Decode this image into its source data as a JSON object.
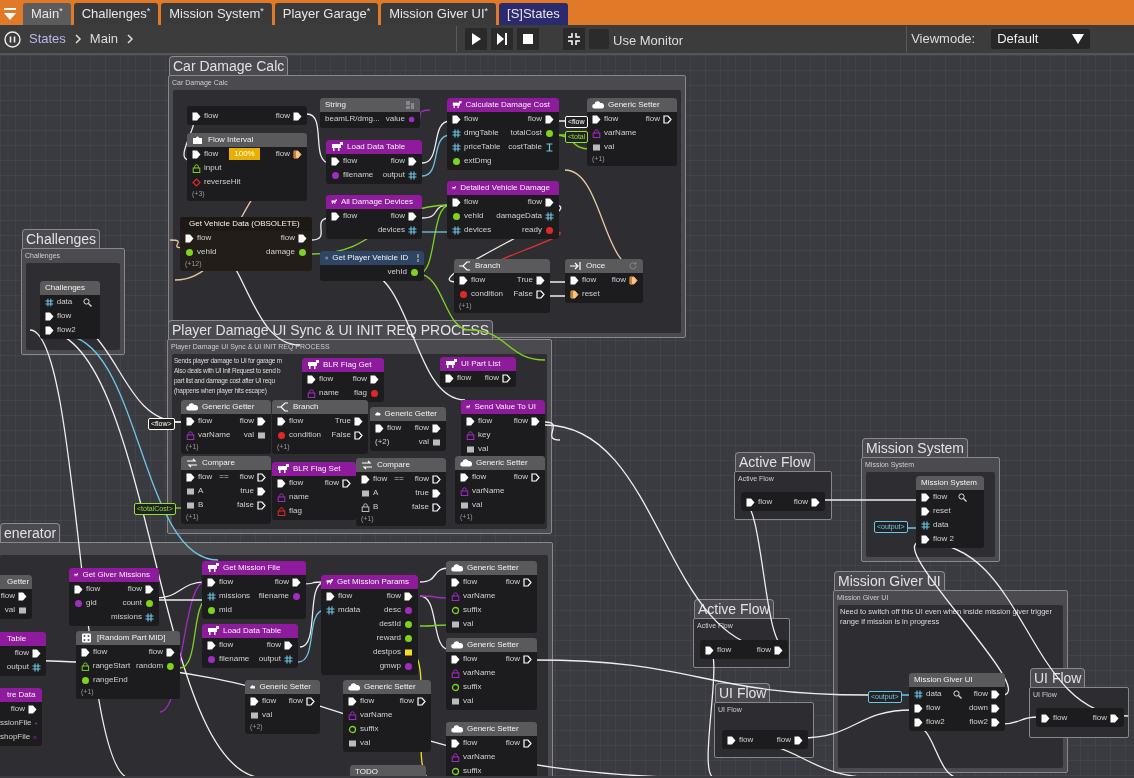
{
  "tabs": [
    {
      "label": "Main$^{*}$",
      "kind": "graph",
      "selected": true
    },
    {
      "label": "Challenges$^{*}$",
      "kind": "graph",
      "selected": false
    },
    {
      "label": "Mission System$^{*}$",
      "kind": "graph",
      "selected": false
    },
    {
      "label": "Player Garage$^{*}$",
      "kind": "graph",
      "selected": false
    },
    {
      "label": "Mission Giver UI$^{*}$",
      "kind": "graph",
      "selected": false
    },
    {
      "label": "[S]States",
      "kind": "state",
      "selected": false
    }
  ],
  "toolbar": {
    "breadcrumb": [
      {
        "label": "States",
        "kind": "link"
      },
      {
        "label": "Main",
        "kind": "current"
      }
    ],
    "use_monitor": {
      "label": "Use Monitor",
      "checked": false
    },
    "viewmode": {
      "label": "Viewmode:",
      "value": "Default"
    }
  },
  "groups": [
    {
      "title": "Car Damage Calc",
      "subtitle": "Car Damage Calc",
      "kind": "panel"
    },
    {
      "title": "Challenges",
      "subtitle": "Challenges",
      "kind": "panel"
    },
    {
      "title": "Player Damage UI Sync & UI INIT REQ PROCESS",
      "subtitle": "Player Damage UI Sync & UI INIT REQ PROCESS",
      "comment": "Sends player damage to UI for garage m\nAlso deals with UI Init Request to send b\npart list and damage cost after UI requ\n(happens when player hits escape)",
      "kind": "panel"
    },
    {
      "title": "enerator",
      "kind": "panel"
    },
    {
      "title": "Active Flow",
      "subtitle": "Active Flow",
      "kind": "compact"
    },
    {
      "title": "Mission System",
      "subtitle": "Mission System",
      "kind": "panel"
    },
    {
      "title": "Active Flow",
      "subtitle": "Active Flow",
      "kind": "compact"
    },
    {
      "title": "Mission Giver UI",
      "subtitle": "Mission Giver UI",
      "comment": "Need to switch off this UI even when inside mission giver trigger range if mission is in progress",
      "kind": "panel"
    },
    {
      "title": "UI Flow",
      "subtitle": "UI Flow",
      "kind": "compact"
    },
    {
      "title": "UI Flow",
      "subtitle": "UI Flow",
      "kind": "compact"
    }
  ],
  "reroutes": [
    {
      "label": "<flow",
      "kind": "flow"
    },
    {
      "label": "<total",
      "kind": "number"
    },
    {
      "label": "<flow>",
      "kind": "flow"
    },
    {
      "label": "<totalCost>",
      "kind": "number"
    },
    {
      "label": "<output>",
      "kind": "table"
    },
    {
      "label": "<output>",
      "kind": "table"
    }
  ],
  "nodes": [
    {
      "kind": "plain",
      "rows": [
        {
          "in": {
            "kind": "flow",
            "label": "flow"
          },
          "out": {
            "kind": "flow",
            "label": "flow"
          }
        }
      ]
    },
    {
      "kind": "interval",
      "title": "Flow Interval",
      "rows": [
        {
          "in": {
            "kind": "flow",
            "label": "flow"
          },
          "badge": "100%",
          "out": {
            "kind": "flow-orange",
            "label": "flow"
          }
        },
        {
          "in": {
            "kind": "lock-green",
            "label": "input"
          }
        },
        {
          "in": {
            "kind": "diamond-red",
            "label": "reverseHit"
          }
        }
      ],
      "footer": "(+3)"
    },
    {
      "kind": "string",
      "title": "String",
      "rows": [
        {
          "in": {
            "label": "beamLR/dmg..."
          },
          "out": {
            "kind": "string",
            "label": "value"
          }
        }
      ]
    },
    {
      "kind": "function",
      "title": "Load Data Table",
      "rows": [
        {
          "in": {
            "kind": "flow",
            "label": "flow"
          },
          "out": {
            "kind": "flow",
            "label": "flow"
          }
        },
        {
          "in": {
            "kind": "string",
            "label": "filename"
          },
          "out": {
            "kind": "table",
            "label": "output"
          }
        }
      ]
    },
    {
      "kind": "function",
      "title": "All Damage Devices",
      "rows": [
        {
          "in": {
            "kind": "flow",
            "label": "flow"
          },
          "out": {
            "kind": "flow",
            "label": "flow"
          }
        },
        {
          "out": {
            "kind": "table",
            "label": "devices"
          }
        }
      ]
    },
    {
      "kind": "vehicle",
      "title": "Get Vehicle Data (OBSOLETE)",
      "rows": [
        {
          "in": {
            "kind": "flow",
            "label": "flow"
          },
          "out": {
            "kind": "flow",
            "label": "flow"
          }
        },
        {
          "in": {
            "kind": "number",
            "label": "vehId"
          },
          "out": {
            "kind": "number",
            "label": "damage"
          }
        }
      ],
      "footer": "(+12)"
    },
    {
      "kind": "global",
      "title": "Get Player Vehicle ID",
      "rows": [
        {
          "out": {
            "kind": "number",
            "label": "vehId"
          }
        }
      ]
    },
    {
      "kind": "function",
      "title": "Calculate Damage Cost",
      "rows": [
        {
          "in": {
            "kind": "flow",
            "label": "flow"
          },
          "out": {
            "kind": "flow",
            "label": "flow"
          }
        },
        {
          "in": {
            "kind": "table",
            "label": "dmgTable"
          },
          "out": {
            "kind": "number",
            "label": "totalCost"
          }
        },
        {
          "in": {
            "kind": "table",
            "label": "priceTable"
          },
          "out": {
            "kind": "cast",
            "label": "costTable"
          }
        },
        {
          "in": {
            "kind": "number",
            "label": "extDmg"
          }
        }
      ]
    },
    {
      "kind": "function",
      "title": "Detailed Vehicle Damage",
      "rows": [
        {
          "in": {
            "kind": "flow",
            "label": "flow"
          },
          "out": {
            "kind": "flow",
            "label": "flow"
          }
        },
        {
          "in": {
            "kind": "number",
            "label": "vehId"
          },
          "out": {
            "kind": "table",
            "label": "damageData"
          }
        },
        {
          "in": {
            "kind": "table",
            "label": "devices"
          },
          "out": {
            "kind": "bool",
            "label": "ready"
          }
        }
      ]
    },
    {
      "kind": "cloud",
      "title": "Generic Setter",
      "rows": [
        {
          "in": {
            "kind": "flow",
            "label": "flow"
          },
          "out": {
            "kind": "flow-open",
            "label": "flow"
          }
        },
        {
          "in": {
            "kind": "lock",
            "label": "varName"
          }
        },
        {
          "in": {
            "kind": "any",
            "label": "val"
          }
        }
      ],
      "footer": "(+1)"
    },
    {
      "kind": "branch",
      "title": "Branch",
      "rows": [
        {
          "in": {
            "kind": "flow",
            "label": "flow"
          },
          "out": {
            "kind": "flow",
            "label": "True"
          }
        },
        {
          "in": {
            "kind": "bool",
            "label": "condition"
          },
          "out": {
            "kind": "flow-open",
            "label": "False"
          }
        }
      ],
      "footer": "(+1)"
    },
    {
      "kind": "once",
      "title": "Once",
      "rows": [
        {
          "in": {
            "kind": "flow",
            "label": "flow"
          },
          "out": {
            "kind": "flow-orange",
            "label": "flow"
          }
        },
        {
          "in": {
            "kind": "flow-orange",
            "label": "reset"
          }
        }
      ]
    },
    {
      "kind": "subgraph",
      "title": "Challenges",
      "rows": [
        {
          "in": {
            "kind": "table",
            "label": "data"
          },
          "inspect": true
        },
        {
          "in": {
            "kind": "flow",
            "label": "flow"
          }
        },
        {
          "in": {
            "kind": "flow",
            "label": "flow2"
          }
        }
      ]
    },
    {
      "kind": "function",
      "title": "BLR Flag Get",
      "rows": [
        {
          "in": {
            "kind": "flow",
            "label": "flow"
          },
          "out": {
            "kind": "flow",
            "label": "flow"
          }
        },
        {
          "in": {
            "kind": "lock",
            "label": "name"
          },
          "out": {
            "kind": "bool",
            "label": "flag"
          }
        }
      ]
    },
    {
      "kind": "function",
      "title": "UI Part List",
      "rows": [
        {
          "in": {
            "kind": "flow",
            "label": "flow"
          },
          "out": {
            "kind": "flow-open",
            "label": "flow"
          }
        }
      ]
    },
    {
      "kind": "cloud",
      "title": "Generic Getter",
      "rows": [
        {
          "in": {
            "kind": "flow",
            "label": "flow"
          },
          "out": {
            "kind": "flow",
            "label": "flow"
          }
        },
        {
          "in": {
            "kind": "lock",
            "label": "varName"
          },
          "out": {
            "kind": "any",
            "label": "val"
          }
        }
      ],
      "footer": "(+1)"
    },
    {
      "kind": "branch",
      "title": "Branch",
      "rows": [
        {
          "in": {
            "kind": "flow",
            "label": "flow"
          },
          "out": {
            "kind": "flow",
            "label": "True"
          }
        },
        {
          "in": {
            "kind": "bool",
            "label": "condition"
          },
          "out": {
            "kind": "flow-open",
            "label": "False"
          }
        }
      ],
      "footer": "(+1)"
    },
    {
      "kind": "cloud",
      "title": "Generic Getter",
      "rows": [
        {
          "in": {
            "kind": "flow",
            "label": "flow"
          },
          "out": {
            "kind": "flow",
            "label": "flow"
          }
        },
        {
          "in": {
            "label": "(+2)"
          },
          "out": {
            "kind": "any",
            "label": "val"
          }
        }
      ]
    },
    {
      "kind": "function",
      "title": "Send Value To UI",
      "rows": [
        {
          "in": {
            "kind": "flow",
            "label": "flow"
          },
          "out": {
            "kind": "flow",
            "label": "flow"
          }
        },
        {
          "in": {
            "kind": "lock",
            "label": "key"
          }
        },
        {
          "in": {
            "kind": "any",
            "label": "val"
          }
        }
      ]
    },
    {
      "kind": "compare",
      "title": "Compare",
      "rows": [
        {
          "in": {
            "kind": "flow",
            "label": "flow"
          },
          "op": "==",
          "out": {
            "kind": "flow-open",
            "label": "flow"
          }
        },
        {
          "in": {
            "kind": "any",
            "label": "A"
          },
          "out": {
            "kind": "flow",
            "label": "true"
          }
        },
        {
          "in": {
            "kind": "any",
            "label": "B"
          },
          "out": {
            "kind": "flow-open",
            "label": "false"
          }
        }
      ],
      "footer": "(+1)"
    },
    {
      "kind": "function",
      "title": "BLR Flag Set",
      "rows": [
        {
          "in": {
            "kind": "flow",
            "label": "flow"
          },
          "out": {
            "kind": "flow-open",
            "label": "flow"
          }
        },
        {
          "in": {
            "kind": "lock",
            "label": "name"
          }
        },
        {
          "in": {
            "kind": "lock-red",
            "label": "flag"
          }
        }
      ]
    },
    {
      "kind": "compare",
      "title": "Compare",
      "rows": [
        {
          "in": {
            "kind": "flow",
            "label": "flow"
          },
          "op": "==",
          "out": {
            "kind": "flow-open",
            "label": "flow"
          }
        },
        {
          "in": {
            "kind": "any",
            "label": "A"
          },
          "out": {
            "kind": "flow",
            "label": "true"
          }
        },
        {
          "in": {
            "kind": "lock-gray",
            "label": "B"
          },
          "out": {
            "kind": "flow-open",
            "label": "false"
          }
        }
      ],
      "footer": "(+1)"
    },
    {
      "kind": "cloud",
      "title": "Generic Setter",
      "rows": [
        {
          "in": {
            "kind": "flow",
            "label": "flow"
          },
          "out": {
            "kind": "flow-open",
            "label": "flow"
          }
        },
        {
          "in": {
            "kind": "lock",
            "label": "varName"
          }
        },
        {
          "in": {
            "kind": "any",
            "label": "val"
          }
        }
      ],
      "footer": "(+1)"
    },
    {
      "kind": "cloud",
      "title": "Getter",
      "partial": true,
      "rows": [
        {
          "out": {
            "kind": "flow",
            "label": "flow"
          }
        },
        {
          "out": {
            "kind": "any",
            "label": "val"
          }
        }
      ]
    },
    {
      "kind": "function",
      "title": "Table",
      "partial": true,
      "rows": [
        {
          "out": {
            "kind": "flow",
            "label": "flow"
          }
        },
        {
          "out": {
            "kind": "table",
            "label": "output"
          }
        }
      ]
    },
    {
      "kind": "function",
      "title": "tre Data",
      "partial": true,
      "rows": [
        {
          "out": {
            "kind": "flow",
            "label": "flow"
          }
        },
        {
          "out": {
            "kind": "string",
            "label": "ssionFile"
          }
        },
        {
          "out": {
            "kind": "string-open",
            "label": "shopFile"
          }
        }
      ]
    },
    {
      "kind": "function",
      "title": "Get Giver Missions",
      "rows": [
        {
          "in": {
            "kind": "flow",
            "label": "flow"
          },
          "out": {
            "kind": "flow",
            "label": "flow"
          }
        },
        {
          "in": {
            "kind": "string",
            "label": "gid"
          },
          "out": {
            "kind": "number",
            "label": "count"
          }
        },
        {
          "out": {
            "kind": "table",
            "label": "missions"
          }
        }
      ]
    },
    {
      "kind": "random",
      "title": "[Random Part MID]",
      "rows": [
        {
          "in": {
            "kind": "flow",
            "label": "flow"
          },
          "out": {
            "kind": "flow",
            "label": "flow"
          }
        },
        {
          "in": {
            "kind": "lock-green",
            "label": "rangeStart"
          },
          "out": {
            "kind": "number",
            "label": "random"
          }
        },
        {
          "in": {
            "kind": "number",
            "label": "rangeEnd"
          }
        }
      ],
      "footer": "(+1)"
    },
    {
      "kind": "function",
      "title": "Get Mission File",
      "rows": [
        {
          "in": {
            "kind": "flow",
            "label": "flow"
          },
          "out": {
            "kind": "flow",
            "label": "flow"
          }
        },
        {
          "in": {
            "kind": "table",
            "label": "missions"
          },
          "out": {
            "kind": "string",
            "label": "filename"
          }
        },
        {
          "in": {
            "kind": "number",
            "label": "mid"
          }
        }
      ]
    },
    {
      "kind": "function",
      "title": "Load Data Table",
      "rows": [
        {
          "in": {
            "kind": "flow",
            "label": "flow"
          },
          "out": {
            "kind": "flow",
            "label": "flow"
          }
        },
        {
          "in": {
            "kind": "string",
            "label": "filename"
          },
          "out": {
            "kind": "table",
            "label": "output"
          }
        }
      ]
    },
    {
      "kind": "function",
      "title": "Get Mission Params",
      "rows": [
        {
          "in": {
            "kind": "flow",
            "label": "flow"
          },
          "out": {
            "kind": "flow",
            "label": "flow"
          }
        },
        {
          "in": {
            "kind": "table",
            "label": "mdata"
          },
          "out": {
            "kind": "string",
            "label": "desc"
          }
        },
        {
          "out": {
            "kind": "number",
            "label": "destId"
          }
        },
        {
          "out": {
            "kind": "number",
            "label": "reward"
          }
        },
        {
          "out": {
            "kind": "vec",
            "label": "destpos"
          }
        },
        {
          "out": {
            "kind": "string",
            "label": "gmwp"
          }
        }
      ]
    },
    {
      "kind": "cloud",
      "title": "Generic Setter",
      "rows": [
        {
          "in": {
            "kind": "flow",
            "label": "flow"
          },
          "out": {
            "kind": "flow-open",
            "label": "flow"
          }
        },
        {
          "in": {
            "kind": "lock",
            "label": "varName"
          }
        },
        {
          "in": {
            "kind": "ring",
            "label": "suffix"
          }
        },
        {
          "in": {
            "kind": "any",
            "label": "val"
          }
        }
      ]
    },
    {
      "kind": "cloud",
      "title": "Generic Setter",
      "rows": [
        {
          "in": {
            "kind": "flow",
            "label": "flow"
          },
          "out": {
            "kind": "flow-open",
            "label": "flow"
          }
        },
        {
          "in": {
            "kind": "lock",
            "label": "varName"
          }
        },
        {
          "in": {
            "kind": "ring",
            "label": "suffix"
          }
        },
        {
          "in": {
            "kind": "any",
            "label": "val"
          }
        }
      ]
    },
    {
      "kind": "cloud",
      "title": "Generic Setter",
      "rows": [
        {
          "in": {
            "kind": "flow",
            "label": "flow"
          },
          "out": {
            "kind": "flow-open",
            "label": "flow"
          }
        },
        {
          "in": {
            "kind": "lock",
            "label": "varName"
          }
        },
        {
          "in": {
            "kind": "ring",
            "label": "suffix"
          }
        }
      ]
    },
    {
      "kind": "cloud",
      "title": "Generic Setter",
      "rows": [
        {
          "in": {
            "kind": "flow",
            "label": "flow"
          },
          "out": {
            "kind": "flow-open",
            "label": "flow"
          }
        },
        {
          "in": {
            "kind": "any",
            "label": "val"
          }
        }
      ],
      "footer": "(+2)"
    },
    {
      "kind": "cloud",
      "title": "Generic Setter",
      "rows": [
        {
          "in": {
            "kind": "flow",
            "label": "flow"
          },
          "out": {
            "kind": "flow-open",
            "label": "flow"
          }
        },
        {
          "in": {
            "kind": "lock",
            "label": "varName"
          }
        },
        {
          "in": {
            "kind": "ring",
            "label": "suffix"
          }
        },
        {
          "in": {
            "kind": "any",
            "label": "val"
          }
        }
      ]
    },
    {
      "kind": "note",
      "title": "TODO"
    },
    {
      "kind": "plain",
      "rows": [
        {
          "in": {
            "kind": "flow",
            "label": "flow"
          },
          "out": {
            "kind": "flow",
            "label": "flow"
          }
        }
      ]
    },
    {
      "kind": "subgraph",
      "title": "Mission System",
      "rows": [
        {
          "in": {
            "kind": "flow",
            "label": "flow"
          },
          "inspect": true
        },
        {
          "in": {
            "kind": "flow",
            "label": "reset"
          }
        },
        {
          "in": {
            "kind": "table",
            "label": "data"
          }
        },
        {
          "in": {
            "kind": "flow",
            "label": "flow 2"
          }
        }
      ]
    },
    {
      "kind": "subgraph",
      "title": "Mission Giver UI",
      "rows": [
        {
          "in": {
            "kind": "table",
            "label": "data"
          },
          "inspect": true,
          "out": {
            "kind": "flow",
            "label": "flow"
          }
        },
        {
          "in": {
            "kind": "flow",
            "label": "flow"
          },
          "out": {
            "kind": "flow",
            "label": "down"
          }
        },
        {
          "in": {
            "kind": "flow",
            "label": "flow2"
          },
          "out": {
            "kind": "flow",
            "label": "flow2"
          }
        }
      ]
    },
    {
      "kind": "plain",
      "rows": [
        {
          "in": {
            "kind": "flow",
            "label": "flow"
          },
          "out": {
            "kind": "flow",
            "label": "flow"
          }
        }
      ]
    },
    {
      "kind": "plain",
      "rows": [
        {
          "in": {
            "kind": "flow",
            "label": "flow"
          },
          "out": {
            "kind": "flow",
            "label": "flow"
          }
        }
      ]
    },
    {
      "kind": "plain",
      "rows": [
        {
          "in": {
            "kind": "flow",
            "label": "flow"
          },
          "out": {
            "kind": "flow",
            "label": "flow"
          }
        }
      ]
    }
  ]
}
